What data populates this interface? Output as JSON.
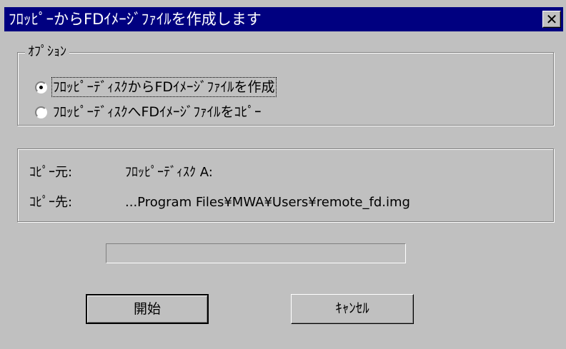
{
  "window": {
    "title": "ﾌﾛｯﾋﾟｰからFDｲﾒｰｼﾞﾌｧｲﾙを作成します",
    "close_glyph": "✕"
  },
  "options": {
    "legend": "ｵﾌﾟｼｮﾝ",
    "items": [
      {
        "label": "ﾌﾛｯﾋﾟｰﾃﾞｨｽｸからFDｲﾒｰｼﾞﾌｧｲﾙを作成",
        "selected": true
      },
      {
        "label": "ﾌﾛｯﾋﾟｰﾃﾞｨｽｸへFDｲﾒｰｼﾞﾌｧｲﾙをｺﾋﾟｰ",
        "selected": false
      }
    ]
  },
  "info": {
    "source_label": "ｺﾋﾟｰ元:",
    "source_value": "ﾌﾛｯﾋﾟｰﾃﾞｨｽｸ A:",
    "dest_label": "ｺﾋﾟｰ先:",
    "dest_value": "...Program Files¥MWA¥Users¥remote_fd.img"
  },
  "progress": {
    "value": 0
  },
  "buttons": {
    "start": "開始",
    "cancel": "ｷｬﾝｾﾙ"
  }
}
